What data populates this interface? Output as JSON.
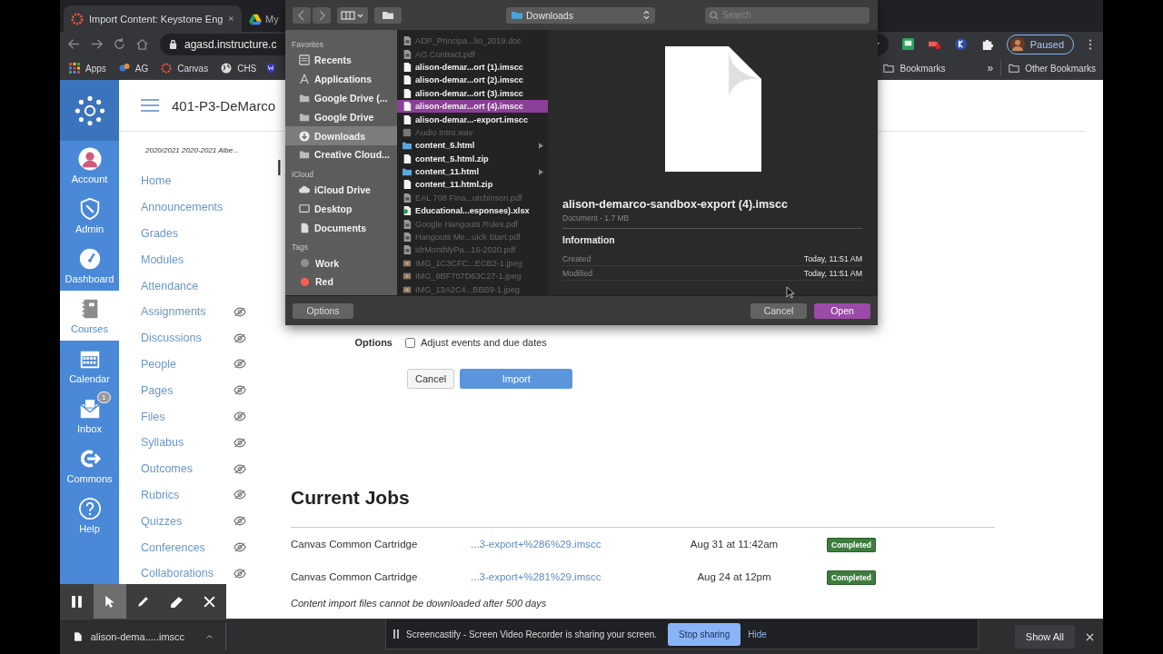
{
  "browser": {
    "tabs": [
      {
        "title": "Import Content: Keystone Eng",
        "selected": true
      },
      {
        "title": "My",
        "selected": false
      }
    ],
    "address": "agasd.instructure.c",
    "profile": "Paused",
    "bookmarks": [
      "Apps",
      "AG",
      "Canvas",
      "CHS"
    ],
    "bookmark_folder": "Bookmarks",
    "overflow": "»",
    "other_bookmarks": "Other Bookmarks"
  },
  "global_nav": [
    {
      "label": "Account",
      "selected": false
    },
    {
      "label": "Admin",
      "selected": false
    },
    {
      "label": "Dashboard",
      "selected": false
    },
    {
      "label": "Courses",
      "selected": true
    },
    {
      "label": "Calendar",
      "selected": false
    },
    {
      "label": "Inbox",
      "selected": false,
      "badge": "1"
    },
    {
      "label": "Commons",
      "selected": false
    },
    {
      "label": "Help",
      "selected": false
    }
  ],
  "course": {
    "title": "401-P3-DeMarco",
    "term": "2020/2021 2020-2021 Albe...",
    "nav": [
      {
        "label": "Home",
        "hidden": false
      },
      {
        "label": "Announcements",
        "hidden": false
      },
      {
        "label": "Grades",
        "hidden": false
      },
      {
        "label": "Modules",
        "hidden": false
      },
      {
        "label": "Attendance",
        "hidden": false
      },
      {
        "label": "Assignments",
        "hidden": true
      },
      {
        "label": "Discussions",
        "hidden": true
      },
      {
        "label": "People",
        "hidden": true
      },
      {
        "label": "Pages",
        "hidden": true
      },
      {
        "label": "Files",
        "hidden": true
      },
      {
        "label": "Syllabus",
        "hidden": true
      },
      {
        "label": "Outcomes",
        "hidden": true
      },
      {
        "label": "Rubrics",
        "hidden": true
      },
      {
        "label": "Quizzes",
        "hidden": true
      },
      {
        "label": "Conferences",
        "hidden": true
      },
      {
        "label": "Collaborations",
        "hidden": true
      }
    ]
  },
  "content": {
    "heading": "I",
    "options_label": "Options",
    "option": {
      "label": "Adjust events and due dates",
      "checked": false
    },
    "cancel": "Cancel",
    "import": "Import",
    "jobs_heading": "Current Jobs",
    "jobs": [
      {
        "type": "Canvas Common Cartridge",
        "file": "...3-export+%286%29.imscc",
        "date": "Aug 31 at 11:42am",
        "status": "Completed"
      },
      {
        "type": "Canvas Common Cartridge",
        "file": "...3-export+%281%29.imscc",
        "date": "Aug 24 at 12pm",
        "status": "Completed"
      }
    ],
    "note": "Content import files cannot be downloaded after 500 days"
  },
  "file_dialog": {
    "location": "Downloads",
    "search_placeholder": "Search",
    "sidebar": [
      {
        "section": "Favorites",
        "items": [
          {
            "label": "Recents",
            "selected": false
          },
          {
            "label": "Applications",
            "selected": false
          },
          {
            "label": "Google Drive (...",
            "selected": false
          },
          {
            "label": "Google Drive",
            "selected": false
          },
          {
            "label": "Downloads",
            "selected": true
          },
          {
            "label": "Creative Cloud...",
            "selected": false
          }
        ]
      },
      {
        "section": "iCloud",
        "items": [
          {
            "label": "iCloud Drive",
            "selected": false
          },
          {
            "label": "Desktop",
            "selected": false
          },
          {
            "label": "Documents",
            "selected": false
          }
        ]
      },
      {
        "section": "Tags",
        "items": [
          {
            "label": "Work",
            "selected": false,
            "color": "#8e8e93"
          },
          {
            "label": "Red",
            "selected": false,
            "color": "#ff5b52"
          }
        ]
      }
    ],
    "files": [
      {
        "name": "ADP_Principa...lio_2019.doc",
        "kind": "doc",
        "disabled": true,
        "selected": false
      },
      {
        "name": "AG Contract.pdf",
        "kind": "pdf",
        "disabled": true,
        "selected": false
      },
      {
        "name": "alison-demar...ort (1).imscc",
        "kind": "file",
        "disabled": false,
        "selected": false
      },
      {
        "name": "alison-demar...ort (2).imscc",
        "kind": "file",
        "disabled": false,
        "selected": false
      },
      {
        "name": "alison-demar...ort (3).imscc",
        "kind": "file",
        "disabled": false,
        "selected": false
      },
      {
        "name": "alison-demar...ort (4).imscc",
        "kind": "file",
        "disabled": false,
        "selected": true
      },
      {
        "name": "alison-demar...-export.imscc",
        "kind": "file",
        "disabled": false,
        "selected": false
      },
      {
        "name": "Audio Intro.wav",
        "kind": "audio",
        "disabled": true,
        "selected": false
      },
      {
        "name": "content_5.html",
        "kind": "folder",
        "disabled": false,
        "selected": false
      },
      {
        "name": "content_5.html.zip",
        "kind": "file",
        "disabled": false,
        "selected": false
      },
      {
        "name": "content_11.html",
        "kind": "folder",
        "disabled": false,
        "selected": false
      },
      {
        "name": "content_11.html.zip",
        "kind": "file",
        "disabled": false,
        "selected": false
      },
      {
        "name": "EAL 708 Fina...utchinson.pdf",
        "kind": "pdf",
        "disabled": true,
        "selected": false
      },
      {
        "name": "Educational...esponses).xlsx",
        "kind": "sheet",
        "disabled": false,
        "selected": false
      },
      {
        "name": "Google Hangouts Rules.pdf",
        "kind": "pdf",
        "disabled": true,
        "selected": false
      },
      {
        "name": "Hangouts Me...uick Start.pdf",
        "kind": "pdf",
        "disabled": true,
        "selected": false
      },
      {
        "name": "idrMonthlyPa...16-2020.pdf",
        "kind": "pdf",
        "disabled": true,
        "selected": false
      },
      {
        "name": "IMG_1C3CFC...ECB2-1.jpeg",
        "kind": "image",
        "disabled": true,
        "selected": false
      },
      {
        "name": "IMG_9BF707D63C27-1.jpeg",
        "kind": "image",
        "disabled": true,
        "selected": false
      },
      {
        "name": "IMG_13A2C4...BBB9-1.jpeg",
        "kind": "image",
        "disabled": true,
        "selected": false
      }
    ],
    "preview": {
      "name": "alison-demarco-sandbox-export (4).imscc",
      "meta": "Document - 1.7 MB",
      "info_heading": "Information",
      "info": [
        {
          "label": "Created",
          "value": "Today, 11:51 AM"
        },
        {
          "label": "Modified",
          "value": "Today, 11:51 AM"
        }
      ]
    },
    "options": "Options",
    "cancel": "Cancel",
    "open": "Open"
  },
  "recorder_tools": [
    {
      "selected": false
    },
    {
      "selected": true
    },
    {
      "selected": false
    },
    {
      "selected": false
    },
    {
      "selected": false
    }
  ],
  "downloads": {
    "file": "alison-dema.....imscc",
    "show_all": "Show All"
  },
  "share_notice": {
    "text": "Screencastify - Screen Video Recorder is sharing your screen.",
    "stop": "Stop sharing",
    "hide": "Hide"
  }
}
